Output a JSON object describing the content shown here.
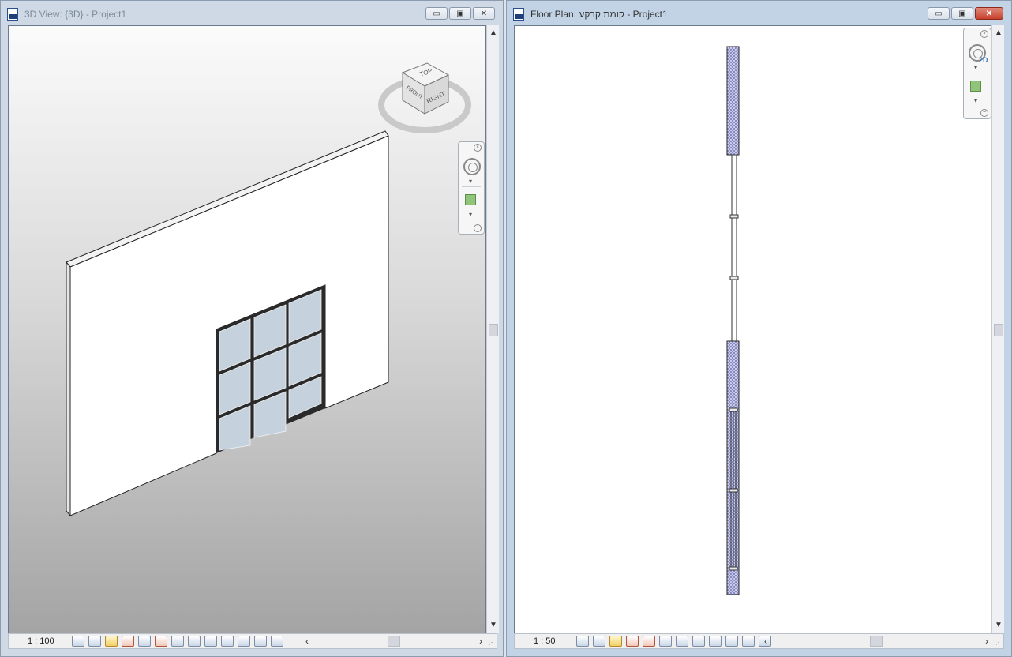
{
  "left_window": {
    "title": "3D View: {3D} - Project1",
    "scale": "1 : 100",
    "viewcube": {
      "top_label": "TOP",
      "front_label": "FRONT",
      "right_label": "RIGHT"
    },
    "controls": {
      "minimize": "▭",
      "restore": "▣",
      "close": "✕"
    }
  },
  "right_window": {
    "title": "Floor Plan: קומת קרקע - Project1",
    "scale": "1 : 50",
    "nav_badge": "2D",
    "controls": {
      "minimize": "▭",
      "restore": "▣",
      "close": "✕"
    }
  },
  "status_tools": [
    "detail-level-icon",
    "visual-style-icon",
    "sun-path-icon",
    "shadows-icon",
    "crop-view-icon",
    "show-crop-icon",
    "unlock-3d-view-icon",
    "temporary-hide-icon",
    "reveal-hidden-icon",
    "analytical-model-icon",
    "highlight-displacement-icon",
    "render-icon",
    "section-box-icon",
    "worksharing-icon"
  ],
  "colors": {
    "wall_hatch": "#8c8fc8",
    "glass": "#c5d2dd",
    "frame": "#222222"
  }
}
